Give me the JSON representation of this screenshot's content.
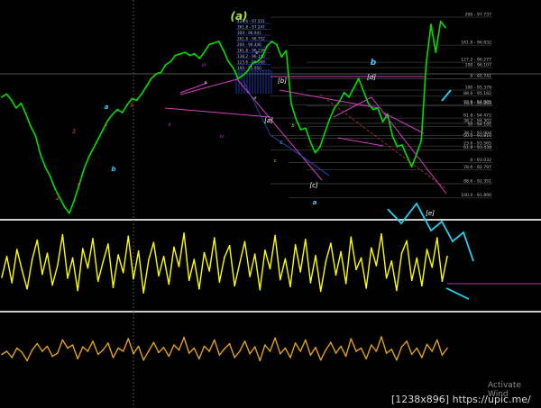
{
  "watermark": "Activate Wind",
  "size_label": "[1238x896] https://upic.me/",
  "chart_data": {
    "type": "line",
    "title": "",
    "xlabel": "",
    "ylabel": "",
    "grid": false,
    "panels": [
      {
        "name": "price",
        "ylim": [
          91.3,
          98.0
        ],
        "series_color": "#00e000",
        "series": [
          {
            "name": "",
            "values": [
              95.15,
              95.25,
              95.05,
              94.8,
              94.95,
              94.6,
              94.2,
              93.9,
              93.3,
              92.9,
              92.6,
              92.2,
              91.9,
              91.6,
              91.4,
              91.8,
              92.3,
              92.8,
              93.2,
              93.5,
              93.8,
              94.1,
              94.4,
              94.6,
              94.75,
              94.65,
              94.9,
              95.1,
              95.05,
              95.25,
              95.5,
              95.75,
              95.9,
              95.95,
              96.2,
              96.3,
              96.5,
              96.55,
              96.6,
              96.5,
              96.55,
              96.4,
              96.6,
              96.85,
              96.9,
              96.95,
              96.65,
              96.3,
              96.1,
              95.75,
              95.85,
              96.0,
              96.25,
              96.3,
              96.45,
              96.8,
              96.95,
              96.85,
              96.45,
              96.65,
              94.95,
              94.45,
              94.1,
              94.15,
              93.7,
              93.35,
              93.55,
              94.0,
              94.45,
              94.8,
              95.0,
              95.3,
              95.15,
              95.45,
              95.75,
              95.35,
              94.95,
              94.75,
              94.8,
              94.35,
              94.6,
              93.9,
              93.55,
              93.6,
              93.25,
              92.9,
              93.3,
              93.75,
              96.2,
              97.5,
              96.6,
              97.6,
              97.4
            ]
          }
        ],
        "levels": [
          {
            "label": "200 - 97.737",
            "value": 97.737
          },
          {
            "label": "161.8 - 96.832",
            "value": 96.832
          },
          {
            "label": "127.2 - 96.277",
            "value": 96.277
          },
          {
            "label": "100 - 96.107",
            "value": 96.107
          },
          {
            "label": "0 - 95.741",
            "value": 95.741
          },
          {
            "label": "100 - 95.378",
            "value": 95.378
          },
          {
            "label": "88.6 - 95.182",
            "value": 95.182
          },
          {
            "label": "23.6 - 94.905",
            "value": 94.905
          },
          {
            "label": "76.4 - 94.869",
            "value": 94.869
          },
          {
            "label": "61.8 - 94.472",
            "value": 94.472
          },
          {
            "label": "38.2 - 94.302",
            "value": 94.302
          },
          {
            "label": "50 - 94.191",
            "value": 94.191
          },
          {
            "label": "38.2 - 93.904",
            "value": 93.904
          },
          {
            "label": "50.0 - 93.816",
            "value": 93.816
          },
          {
            "label": "23.6 - 93.565",
            "value": 93.565
          },
          {
            "label": "61.8 - 93.438",
            "value": 93.438
          },
          {
            "label": "0 - 93.032",
            "value": 93.032
          },
          {
            "label": "78.6 - 92.797",
            "value": 92.797
          },
          {
            "label": "88.6 - 92.351",
            "value": 92.351
          },
          {
            "label": "100.0 - 91.890",
            "value": 91.89
          }
        ],
        "top_levels": [
          {
            "label": "423.6 - 97.551",
            "value": 97.551
          },
          {
            "label": "361.8 - 97.247",
            "value": 97.247
          },
          {
            "label": "300 - 96.941",
            "value": 96.941
          },
          {
            "label": "261.8 - 96.752",
            "value": 96.752
          },
          {
            "label": "200 - 96.446",
            "value": 96.446
          },
          {
            "label": "161.8 - 96.256",
            "value": 96.256
          },
          {
            "label": "138.2 - 96.140",
            "value": 96.14
          },
          {
            "label": "123.6 - 96.068",
            "value": 96.068
          },
          {
            "label": "100 - 95.950",
            "value": 95.95
          }
        ],
        "wave_labels": [
          {
            "text": "(a)",
            "color": "#a8e040"
          },
          {
            "text": "b",
            "color": "#3ad0ff"
          },
          {
            "text": "a",
            "color": "#3ad0ff"
          },
          {
            "text": "b",
            "color": "#3ad0ff"
          },
          {
            "text": "a",
            "color": "#3ad0ff"
          },
          {
            "text": "c",
            "color": "#3ad0ff"
          },
          {
            "text": "[b]",
            "color": "#ffffff"
          },
          {
            "text": "[a]",
            "color": "#ffffff"
          },
          {
            "text": "[c]",
            "color": "#ffffff"
          },
          {
            "text": "[d]",
            "color": "#ffffff"
          },
          {
            "text": "[e]",
            "color": "#ffffff"
          },
          {
            "text": "iii",
            "color": "#d030ff"
          },
          {
            "text": "iv",
            "color": "#d030ff"
          },
          {
            "text": "ii",
            "color": "#d030ff"
          },
          {
            "text": "v",
            "color": "#ffffff"
          },
          {
            "text": "a",
            "color": "#a8e040"
          },
          {
            "text": "b",
            "color": "#a8e040"
          },
          {
            "text": "c",
            "color": "#a8e040"
          },
          {
            "text": "e",
            "color": "#a8e040"
          },
          {
            "text": "1",
            "color": "#ff5020"
          },
          {
            "text": "2",
            "color": "#ff5020"
          },
          {
            "text": "3",
            "color": "#ff5020"
          },
          {
            "text": "4",
            "color": "#ff5020"
          },
          {
            "text": "5",
            "color": "#ff5020"
          }
        ]
      },
      {
        "name": "oscillator-1",
        "series_color": "#ffff00",
        "series": [
          {
            "name": "",
            "values": [
              0.35,
              0.62,
              0.28,
              0.71,
              0.44,
              0.2,
              0.58,
              0.83,
              0.39,
              0.66,
              0.25,
              0.5,
              0.9,
              0.34,
              0.6,
              0.18,
              0.72,
              0.47,
              0.85,
              0.3,
              0.55,
              0.78,
              0.22,
              0.64,
              0.41,
              0.88,
              0.33,
              0.69,
              0.15,
              0.57,
              0.8,
              0.37,
              0.62,
              0.26,
              0.74,
              0.49,
              0.92,
              0.31,
              0.58,
              0.2,
              0.67,
              0.43,
              0.86,
              0.29,
              0.61,
              0.76,
              0.24,
              0.53,
              0.81,
              0.36,
              0.65,
              0.19,
              0.7,
              0.46,
              0.89,
              0.32,
              0.59,
              0.23,
              0.77,
              0.42,
              0.84,
              0.28,
              0.63,
              0.17,
              0.55,
              0.79,
              0.38,
              0.68,
              0.27,
              0.87,
              0.45,
              0.6,
              0.21,
              0.73,
              0.5,
              0.91,
              0.34,
              0.56,
              0.18,
              0.66,
              0.82,
              0.31,
              0.6,
              0.24,
              0.71,
              0.48,
              0.86,
              0.3,
              0.62
            ]
          }
        ]
      },
      {
        "name": "oscillator-2",
        "series_color": "#e0a020",
        "series": [
          {
            "name": "",
            "values": [
              0.45,
              0.5,
              0.4,
              0.55,
              0.48,
              0.35,
              0.52,
              0.62,
              0.5,
              0.58,
              0.42,
              0.47,
              0.68,
              0.55,
              0.6,
              0.38,
              0.57,
              0.5,
              0.66,
              0.45,
              0.52,
              0.63,
              0.4,
              0.55,
              0.5,
              0.7,
              0.46,
              0.58,
              0.36,
              0.5,
              0.64,
              0.48,
              0.56,
              0.42,
              0.6,
              0.52,
              0.72,
              0.47,
              0.55,
              0.38,
              0.58,
              0.5,
              0.68,
              0.44,
              0.54,
              0.62,
              0.4,
              0.5,
              0.66,
              0.46,
              0.57,
              0.35,
              0.6,
              0.5,
              0.71,
              0.46,
              0.55,
              0.4,
              0.63,
              0.5,
              0.68,
              0.44,
              0.56,
              0.36,
              0.52,
              0.64,
              0.47,
              0.58,
              0.42,
              0.7,
              0.5,
              0.55,
              0.38,
              0.6,
              0.5,
              0.73,
              0.47,
              0.53,
              0.36,
              0.57,
              0.66,
              0.45,
              0.55,
              0.4,
              0.61,
              0.5,
              0.68,
              0.44,
              0.55
            ]
          }
        ]
      }
    ]
  }
}
